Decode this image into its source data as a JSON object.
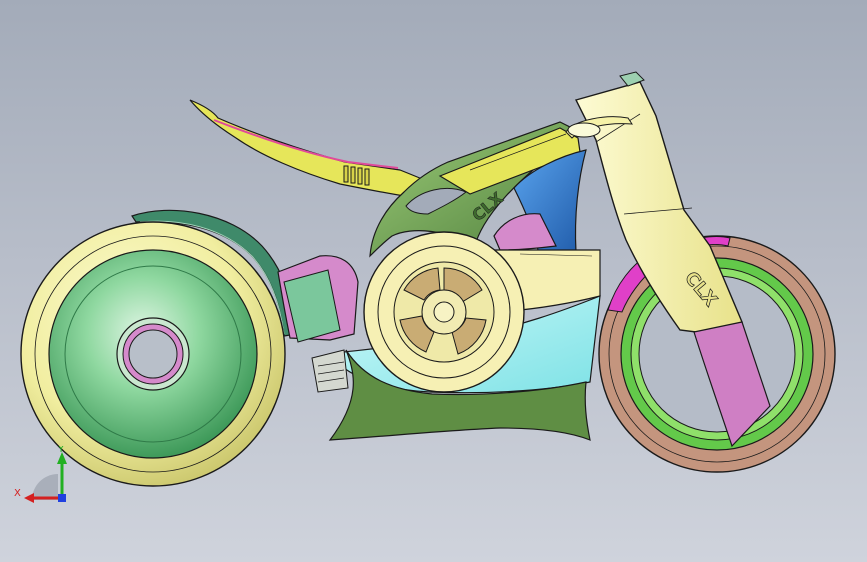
{
  "viewport": {
    "background_top": "#a3abb9",
    "background_bottom": "#cfd3dc",
    "edge_color": "#1a1a1a"
  },
  "model": {
    "tank_logo": "CLX",
    "fork_logo": "CLX",
    "colors": {
      "tire": "#f3f0a6",
      "rear_rim": "#7ccf8e",
      "front_tire": "#c4957e",
      "front_rim": "#63c94a",
      "fork": "#f6f2a8",
      "fork_lower": "#cf7fc4",
      "frame": "#6a9f52",
      "seat": "#e6e65a",
      "belly_pan": "#98eef0",
      "radiator": "#2c72c8",
      "fender": "#3f8a6a",
      "magenta_parts": "#e040c8",
      "engine_cover": "#f6f0b4"
    }
  },
  "triad": {
    "x_label": "X",
    "y_label": "Y",
    "x_color": "#d42020",
    "y_color": "#22b022",
    "z_color": "#2040e0"
  }
}
